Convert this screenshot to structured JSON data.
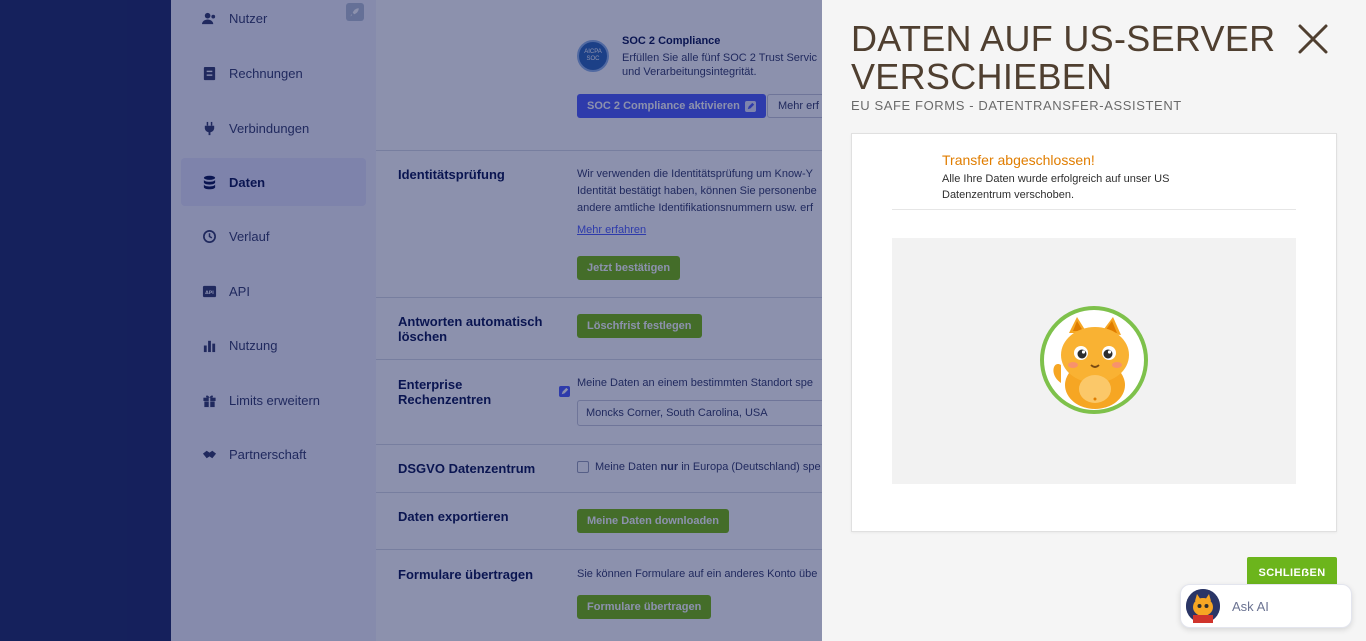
{
  "sidebar": {
    "items": [
      {
        "label": "Nutzer",
        "icon": "users-icon"
      },
      {
        "label": "Rechnungen",
        "icon": "invoice-icon"
      },
      {
        "label": "Verbindungen",
        "icon": "plug-icon"
      },
      {
        "label": "Daten",
        "icon": "database-icon",
        "active": true
      },
      {
        "label": "Verlauf",
        "icon": "history-icon"
      },
      {
        "label": "API",
        "icon": "api-icon"
      },
      {
        "label": "Nutzung",
        "icon": "bar-chart-icon"
      },
      {
        "label": "Limits erweitern",
        "icon": "gift-icon"
      },
      {
        "label": "Partnerschaft",
        "icon": "handshake-icon"
      }
    ]
  },
  "main": {
    "soc": {
      "badge_line1": "AICPA",
      "badge_line2": "SOC",
      "title": "SOC 2 Compliance",
      "text_line1": "Erfüllen Sie alle fünf SOC 2 Trust Servic",
      "text_line2": "und Verarbeitungsintegrität.",
      "activate_button": "SOC 2 Compliance aktivieren",
      "more_button": "Mehr erf"
    },
    "identity": {
      "title": "Identitätsprüfung",
      "text_line1": "Wir verwenden die Identitätsprüfung um Know-Y",
      "text_line2": "Identität bestätigt haben, können Sie personenbe",
      "text_line3": "andere amtliche Identifikationsnummern usw. erf",
      "link": "Mehr erfahren",
      "button": "Jetzt bestätigen"
    },
    "auto_delete": {
      "title": "Antworten automatisch löschen",
      "button": "Löschfrist festlegen"
    },
    "enterprise": {
      "title": "Enterprise Rechenzentren",
      "text": "Meine Daten an einem bestimmten Standort spe",
      "location": "Moncks Corner, South Carolina, USA"
    },
    "gdpr": {
      "title": "DSGVO Datenzentrum",
      "text_pre": "Meine Daten ",
      "text_bold": "nur",
      "text_post": " in Europa (Deutschland) spe"
    },
    "export": {
      "title": "Daten exportieren",
      "button": "Meine Daten downloaden"
    },
    "transfer": {
      "title": "Formulare übertragen",
      "text": "Sie können Formulare auf ein anderes Konto übe",
      "button": "Formulare übertragen"
    }
  },
  "drawer": {
    "title": "DATEN AUF US-SERVER VERSCHIEBEN",
    "subtitle": "EU SAFE FORMS - DATENTRANSFER-ASSISTENT",
    "status_title": "Transfer abgeschlossen!",
    "status_text": "Alle Ihre Daten wurde erfolgreich auf unser US Datenzentrum verschoben.",
    "close_button": "SCHLIEẞEN"
  },
  "ask_ai": {
    "label": "Ask AI"
  },
  "colors": {
    "far_left": "#1f2b66",
    "accent_green": "#78bb07",
    "accent_blue": "#4e5dfb",
    "status_orange": "#e07d00",
    "title_brown": "#4f3f30"
  }
}
